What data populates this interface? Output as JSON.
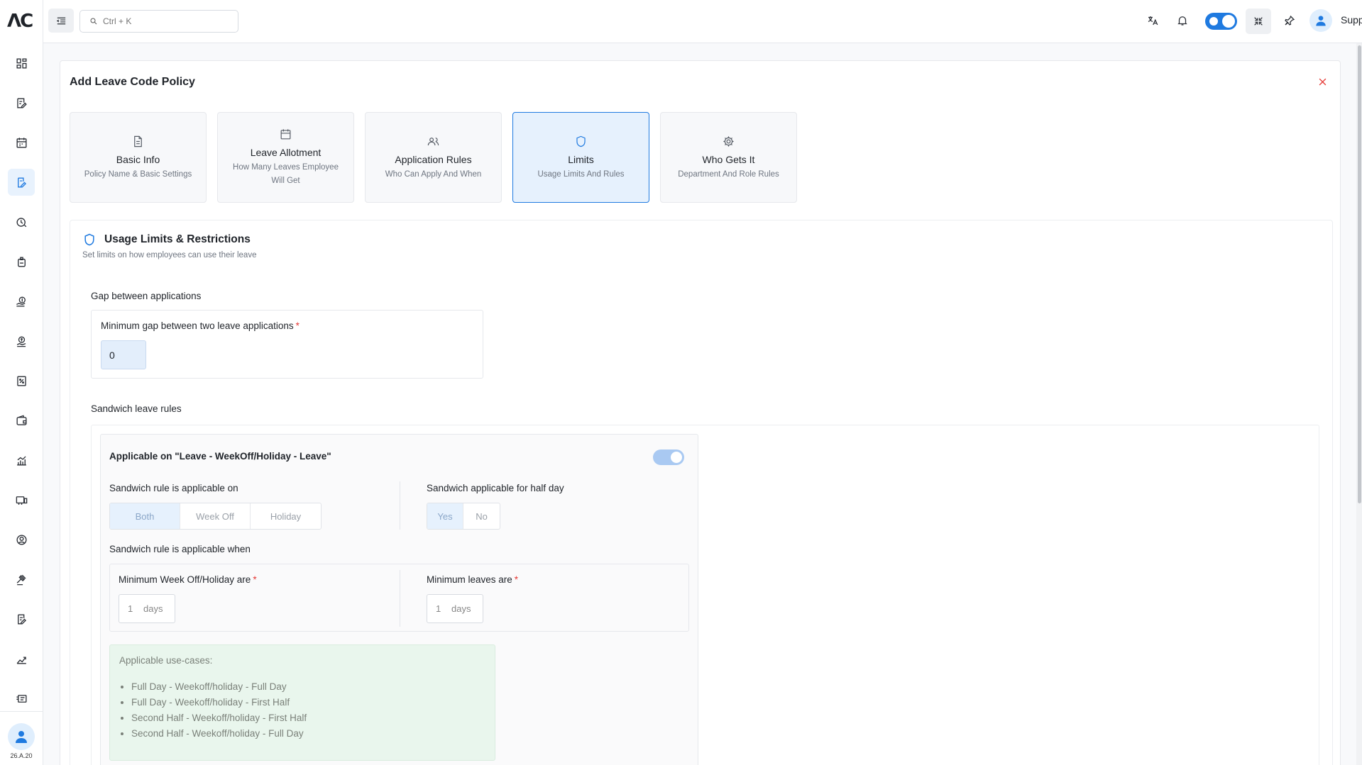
{
  "app": {
    "logo_text": "ΛC",
    "version": "26.A.20"
  },
  "sidebar": {
    "items": [
      {
        "name": "dashboard-icon",
        "active": false
      },
      {
        "name": "form-icon",
        "active": false
      },
      {
        "name": "calendar-icon",
        "active": false
      },
      {
        "name": "leave-policy-icon",
        "active": true
      },
      {
        "name": "clock-icon",
        "active": false
      },
      {
        "name": "badge-icon",
        "active": false
      },
      {
        "name": "hand-coin-icon",
        "active": false
      },
      {
        "name": "payroll-icon",
        "active": false
      },
      {
        "name": "tax-icon",
        "active": false
      },
      {
        "name": "wallet-icon",
        "active": false
      },
      {
        "name": "growth-icon",
        "active": false
      },
      {
        "name": "assets-icon",
        "active": false
      },
      {
        "name": "user-circle-icon",
        "active": false
      },
      {
        "name": "gavel-icon",
        "active": false
      },
      {
        "name": "document-edit-icon",
        "active": false
      },
      {
        "name": "analytics-icon",
        "active": false
      },
      {
        "name": "id-card-icon",
        "active": false
      }
    ]
  },
  "topbar": {
    "search_placeholder": "Ctrl + K",
    "user_name": "Support"
  },
  "dialog": {
    "title": "Add Leave Code Policy",
    "steps": [
      {
        "title": "Basic Info",
        "subtitle": "Policy Name & Basic Settings",
        "icon": "document-icon"
      },
      {
        "title": "Leave Allotment",
        "subtitle": "How Many Leaves Employee Will Get",
        "icon": "calendar-icon"
      },
      {
        "title": "Application Rules",
        "subtitle": "Who Can Apply And When",
        "icon": "users-icon"
      },
      {
        "title": "Limits",
        "subtitle": "Usage Limits And Rules",
        "icon": "shield-icon"
      },
      {
        "title": "Who Gets It",
        "subtitle": "Department And Role Rules",
        "icon": "gear-icon"
      }
    ],
    "active_step": 3
  },
  "limits": {
    "title": "Usage Limits & Restrictions",
    "subtitle": "Set limits on how employees can use their leave",
    "gap": {
      "heading": "Gap between applications",
      "field_label": "Minimum gap between two leave applications",
      "required_mark": "*",
      "value": "0"
    },
    "sandwich": {
      "heading": "Sandwich leave rules",
      "applicable_label": "Applicable on \"Leave - WeekOff/Holiday - Leave\"",
      "applicable_enabled": true,
      "applicable_on_label": "Sandwich rule is applicable on",
      "applicable_on_options": [
        "Both",
        "Week Off",
        "Holiday"
      ],
      "applicable_on_selected": "Both",
      "half_day_label": "Sandwich applicable for half day",
      "half_day_options": [
        "Yes",
        "No"
      ],
      "half_day_selected": "Yes",
      "when_label": "Sandwich rule is applicable when",
      "min_weekoff_label": "Minimum Week Off/Holiday are",
      "min_weekoff_value": "1",
      "min_leaves_label": "Minimum leaves are",
      "min_leaves_value": "1",
      "unit": "days",
      "usecases_title": "Applicable use-cases:",
      "usecases": [
        "Full Day - Weekoff/holiday - Full Day",
        "Full Day - Weekoff/holiday - First Half",
        "Second Half - Weekoff/holiday - First Half",
        "Second Half - Weekoff/holiday - Full Day"
      ]
    }
  },
  "colors": {
    "accent": "#1f7ae0",
    "danger": "#e53935",
    "usecase_bg": "#e9f6ed"
  }
}
